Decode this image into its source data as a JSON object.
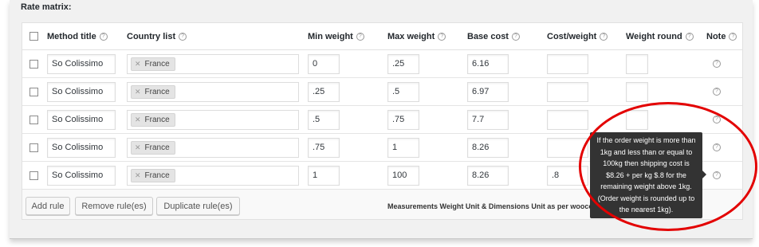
{
  "section_title": "Rate matrix:",
  "headers": {
    "method_title": "Method title",
    "country_list": "Country list",
    "min_weight": "Min weight",
    "max_weight": "Max weight",
    "base_cost": "Base cost",
    "cost_weight": "Cost/weight",
    "weight_round": "Weight round",
    "note": "Note"
  },
  "rows": [
    {
      "method": "So Colissimo",
      "country": "France",
      "min": "0",
      "max": ".25",
      "base": "6.16",
      "cost_weight": "",
      "round": ""
    },
    {
      "method": "So Colissimo",
      "country": "France",
      "min": ".25",
      "max": ".5",
      "base": "6.97",
      "cost_weight": "",
      "round": ""
    },
    {
      "method": "So Colissimo",
      "country": "France",
      "min": ".5",
      "max": ".75",
      "base": "7.7",
      "cost_weight": "",
      "round": ""
    },
    {
      "method": "So Colissimo",
      "country": "France",
      "min": ".75",
      "max": "1",
      "base": "8.26",
      "cost_weight": "",
      "round": ""
    },
    {
      "method": "So Colissimo",
      "country": "France",
      "min": "1",
      "max": "100",
      "base": "8.26",
      "cost_weight": ".8",
      "round": ""
    }
  ],
  "buttons": {
    "add_rule": "Add rule",
    "remove_rules": "Remove rule(es)",
    "duplicate_rules": "Duplicate rule(es)"
  },
  "footer_note": "Measurements Weight Unit & Dimensions Unit as per woocomm",
  "tooltip": "If the order weight is more than 1kg and less than or equal to 100kg then shipping cost is $8.26 + per kg $.8 for the remaining weight above 1kg.(Order weight is rounded up to the nearest 1kg).",
  "icons": {
    "help": "question-circle-icon",
    "remove_chip": "x-icon"
  },
  "colors": {
    "highlight_oval": "#e30000",
    "tooltip_bg": "#333333"
  }
}
